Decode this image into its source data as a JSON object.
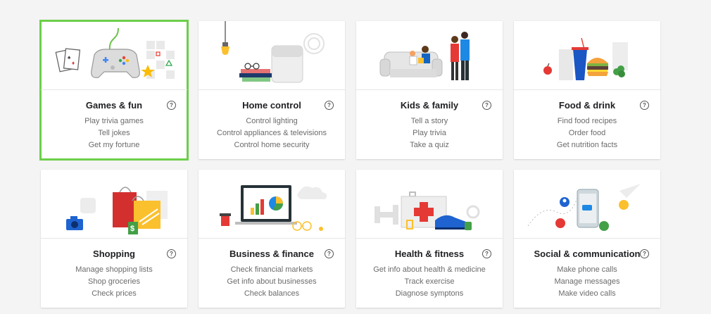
{
  "categories": [
    {
      "title": "Games & fun",
      "examples": [
        "Play trivia games",
        "Tell jokes",
        "Get my fortune"
      ],
      "icon": "game-controller-illustration",
      "selected": true,
      "selection_color": "#6ccf4a"
    },
    {
      "title": "Home control",
      "examples": [
        "Control lighting",
        "Control appliances & televisions",
        "Control home security"
      ],
      "icon": "smart-speaker-illustration"
    },
    {
      "title": "Kids & family",
      "examples": [
        "Tell a story",
        "Play trivia",
        "Take a quiz"
      ],
      "icon": "family-couch-illustration"
    },
    {
      "title": "Food & drink",
      "examples": [
        "Find food recipes",
        "Order food",
        "Get nutrition facts"
      ],
      "icon": "burger-drink-illustration"
    },
    {
      "title": "Shopping",
      "examples": [
        "Manage shopping lists",
        "Shop groceries",
        "Check prices"
      ],
      "icon": "shopping-bags-illustration"
    },
    {
      "title": "Business & finance",
      "examples": [
        "Check financial markets",
        "Get info about businesses",
        "Check balances"
      ],
      "icon": "laptop-charts-illustration"
    },
    {
      "title": "Health & fitness",
      "examples": [
        "Get info about health & medicine",
        "Track exercise",
        "Diagnose symptons"
      ],
      "icon": "first-aid-sneaker-illustration"
    },
    {
      "title": "Social & communication",
      "examples": [
        "Make phone calls",
        "Manage messages",
        "Make video calls"
      ],
      "icon": "phone-messages-illustration"
    }
  ],
  "help_icon": "question-circle-icon"
}
